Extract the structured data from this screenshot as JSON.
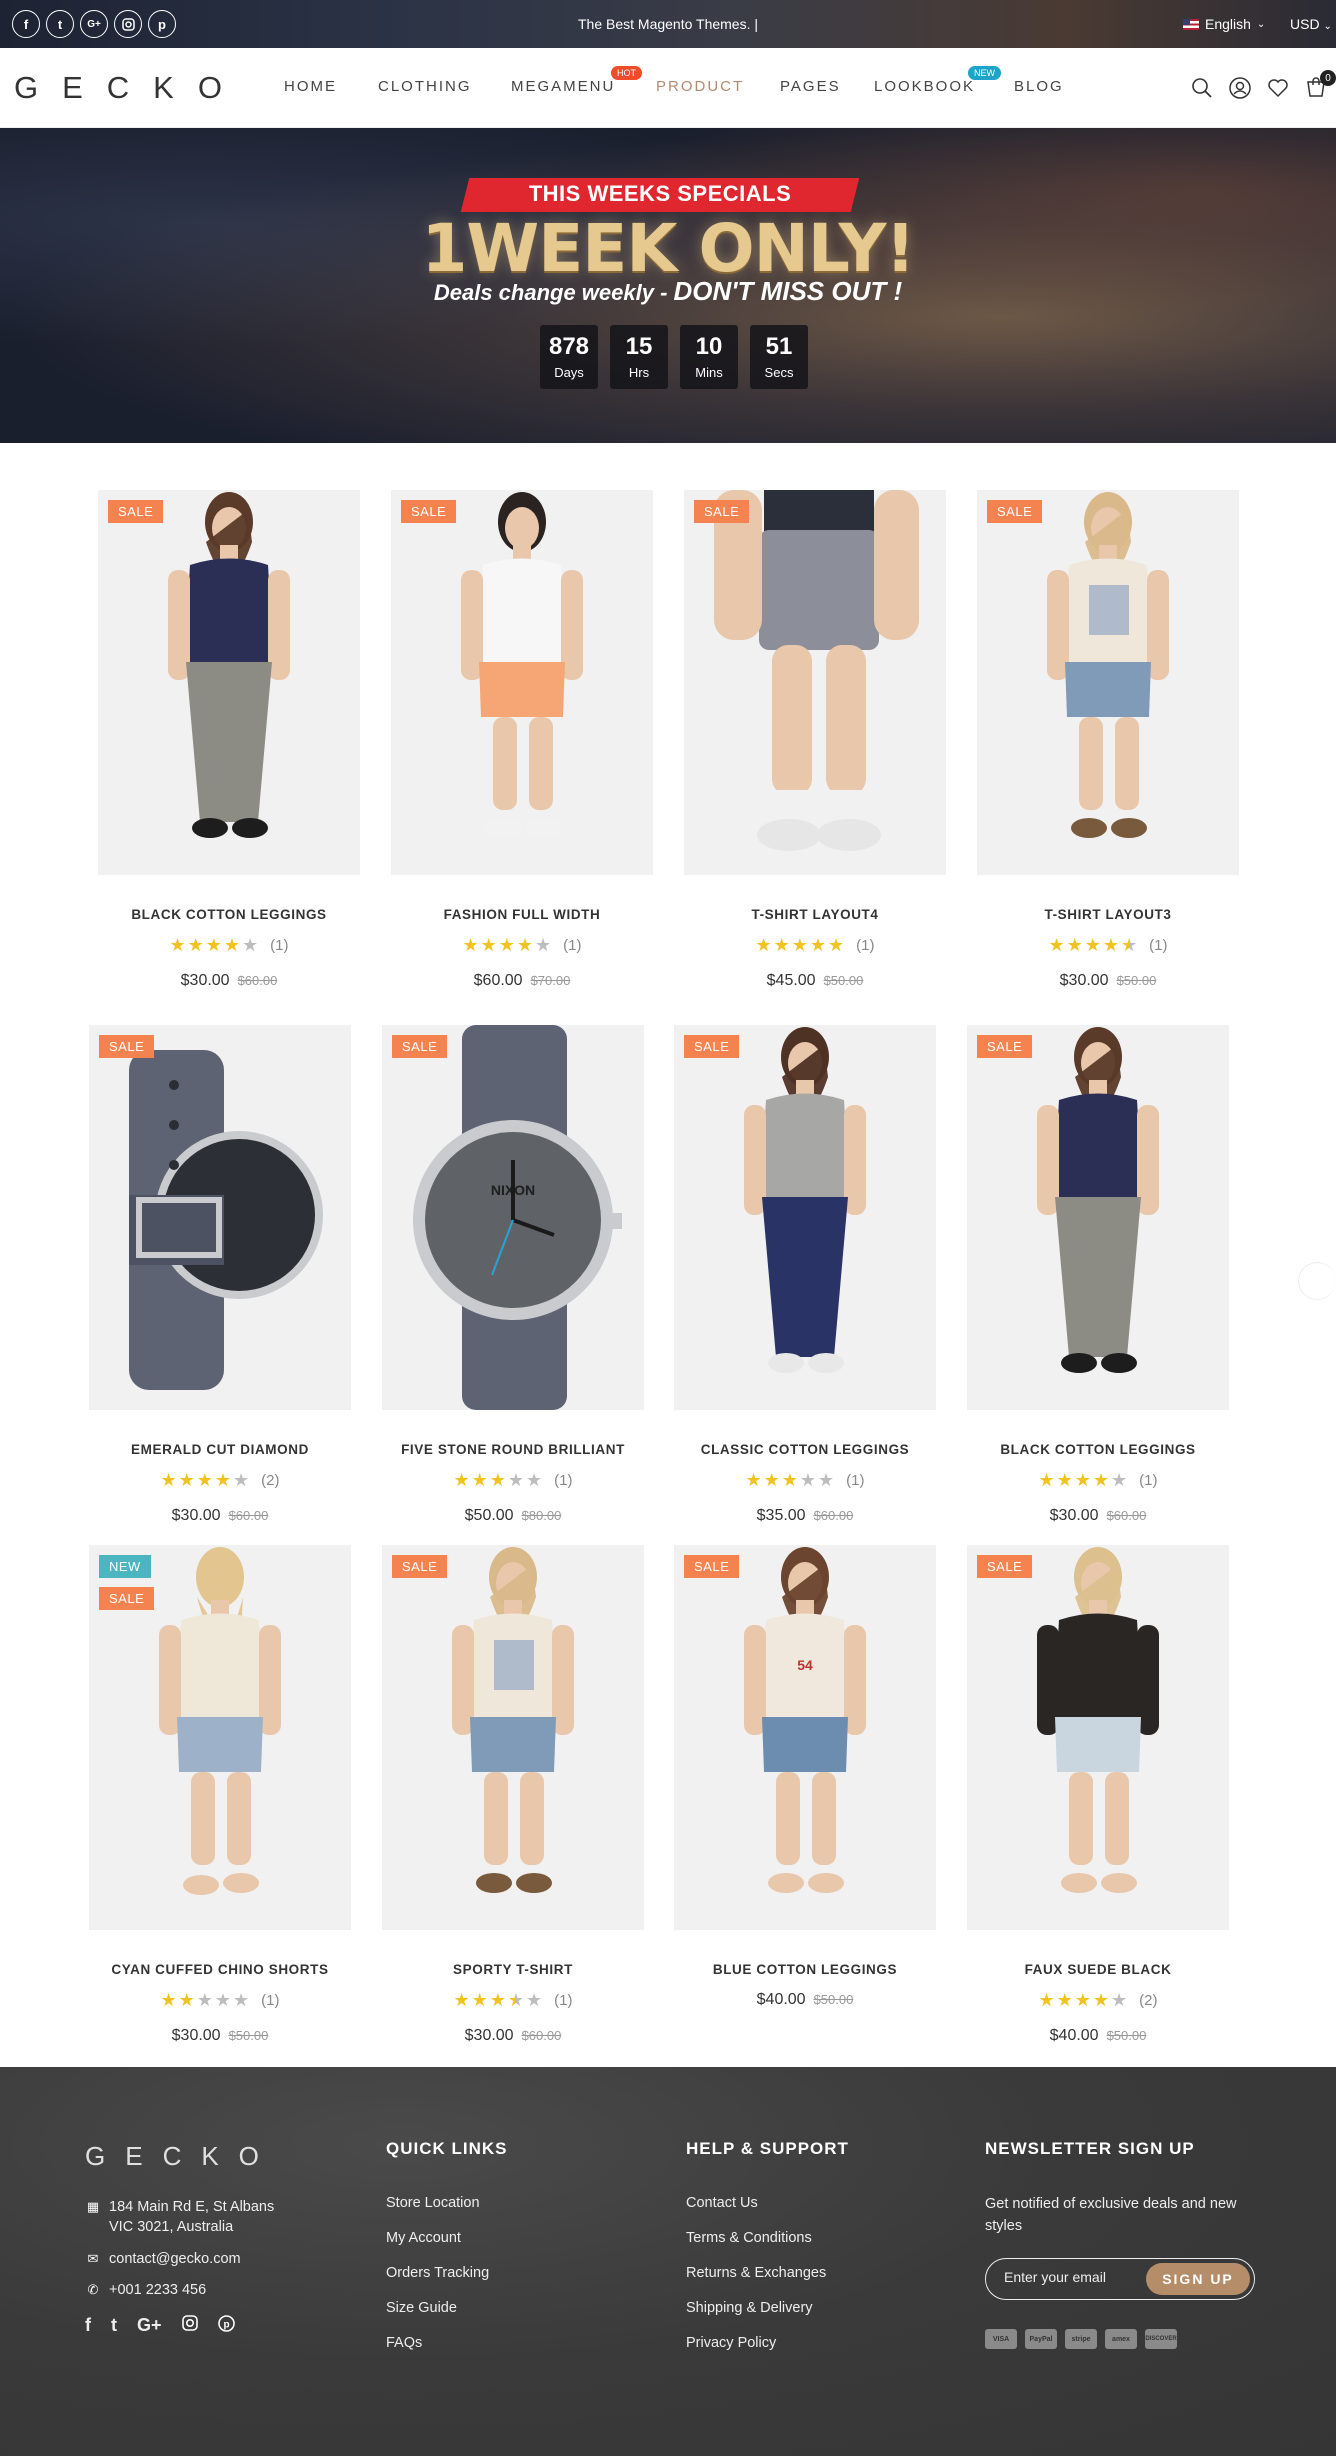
{
  "topbar": {
    "tagline": "The Best Magento Themes. |",
    "language": "English",
    "currency": "USD",
    "socials": [
      "facebook-icon",
      "twitter-icon",
      "google-plus-icon",
      "instagram-icon",
      "pinterest-icon"
    ]
  },
  "header": {
    "logo": "GECKO",
    "nav": [
      {
        "label": "HOME"
      },
      {
        "label": "CLOTHING"
      },
      {
        "label": "MEGAMENU",
        "badge": "HOT"
      },
      {
        "label": "PRODUCT",
        "active": true
      },
      {
        "label": "PAGES"
      },
      {
        "label": "LOOKBOOK",
        "badge": "NEW"
      },
      {
        "label": "BLOG"
      }
    ],
    "cart_count": "0"
  },
  "hero": {
    "ribbon": "THIS WEEKS SPECIALS",
    "headline": "1WEEK ONLY!",
    "sub_lead": "Deals change weekly - ",
    "sub_emphasis": "DON'T MISS OUT !",
    "countdown": [
      {
        "value": "878",
        "label": "Days"
      },
      {
        "value": "15",
        "label": "Hrs"
      },
      {
        "value": "10",
        "label": "Mins"
      },
      {
        "value": "51",
        "label": "Secs"
      }
    ]
  },
  "products": [
    {
      "name": "BLACK COTTON LEGGINGS",
      "rating": 4,
      "reviews": "(1)",
      "price": "$30.00",
      "old_price": "$60.00",
      "badges": [
        "SALE"
      ],
      "art": "woman-navy-tee"
    },
    {
      "name": "FASHION FULL WIDTH",
      "rating": 4,
      "reviews": "(1)",
      "price": "$60.00",
      "old_price": "$70.00",
      "badges": [
        "SALE"
      ],
      "art": "man-white-tee"
    },
    {
      "name": "T-SHIRT LAYOUT4",
      "rating": 5,
      "reviews": "(1)",
      "price": "$45.00",
      "old_price": "$50.00",
      "badges": [
        "SALE"
      ],
      "art": "man-shorts"
    },
    {
      "name": "T-SHIRT LAYOUT3",
      "rating": 4.5,
      "reviews": "(1)",
      "price": "$30.00",
      "old_price": "$50.00",
      "badges": [
        "SALE"
      ],
      "art": "woman-print-tee"
    },
    {
      "name": "EMERALD CUT DIAMOND",
      "rating": 4,
      "reviews": "(2)",
      "price": "$30.00",
      "old_price": "$60.00",
      "badges": [
        "SALE"
      ],
      "art": "watch-back"
    },
    {
      "name": "FIVE STONE ROUND BRILLIANT",
      "rating": 3,
      "reviews": "(1)",
      "price": "$50.00",
      "old_price": "$80.00",
      "badges": [
        "SALE"
      ],
      "art": "watch-front",
      "dial_brand": "NIXON"
    },
    {
      "name": "CLASSIC COTTON LEGGINGS",
      "rating": 3,
      "reviews": "(1)",
      "price": "$35.00",
      "old_price": "$60.00",
      "badges": [
        "SALE"
      ],
      "art": "woman-grey-tee"
    },
    {
      "name": "BLACK COTTON LEGGINGS",
      "rating": 4,
      "reviews": "(1)",
      "price": "$30.00",
      "old_price": "$60.00",
      "badges": [
        "SALE"
      ],
      "art": "woman-navy-tee"
    },
    {
      "name": "CYAN CUFFED CHINO SHORTS",
      "rating": 2,
      "reviews": "(1)",
      "price": "$30.00",
      "old_price": "$50.00",
      "badges": [
        "NEW",
        "SALE"
      ],
      "art": "woman-back"
    },
    {
      "name": "SPORTY T-SHIRT",
      "rating": 3.5,
      "reviews": "(1)",
      "price": "$30.00",
      "old_price": "$60.00",
      "badges": [
        "SALE"
      ],
      "art": "woman-print-tee"
    },
    {
      "name": "BLUE COTTON LEGGINGS",
      "rating": null,
      "reviews": "",
      "price": "$40.00",
      "old_price": "$50.00",
      "badges": [
        "SALE"
      ],
      "art": "woman-greenwich"
    },
    {
      "name": "FAUX SUEDE BLACK",
      "rating": 4,
      "reviews": "(2)",
      "price": "$40.00",
      "old_price": "$50.00",
      "badges": [
        "SALE"
      ],
      "art": "woman-black-top"
    }
  ],
  "footer": {
    "logo": "GECKO",
    "address_line1": "184 Main Rd E, St Albans",
    "address_line2": "VIC 3021, Australia",
    "email": "contact@gecko.com",
    "phone": "+001 2233 456",
    "quick_links_title": "QUICK LINKS",
    "quick_links": [
      "Store Location",
      "My Account",
      "Orders Tracking",
      "Size Guide",
      "FAQs"
    ],
    "help_title": "HELP & SUPPORT",
    "help_links": [
      "Contact Us",
      "Terms & Conditions",
      "Returns & Exchanges",
      "Shipping & Delivery",
      "Privacy Policy"
    ],
    "newsletter_title": "NEWSLETTER SIGN UP",
    "newsletter_text": "Get notified of exclusive deals and new styles",
    "newsletter_placeholder": "Enter your email",
    "newsletter_button": "SIGN UP",
    "payments": [
      "VISA",
      "PayPal",
      "stripe",
      "amex",
      "DISCOVER"
    ]
  }
}
